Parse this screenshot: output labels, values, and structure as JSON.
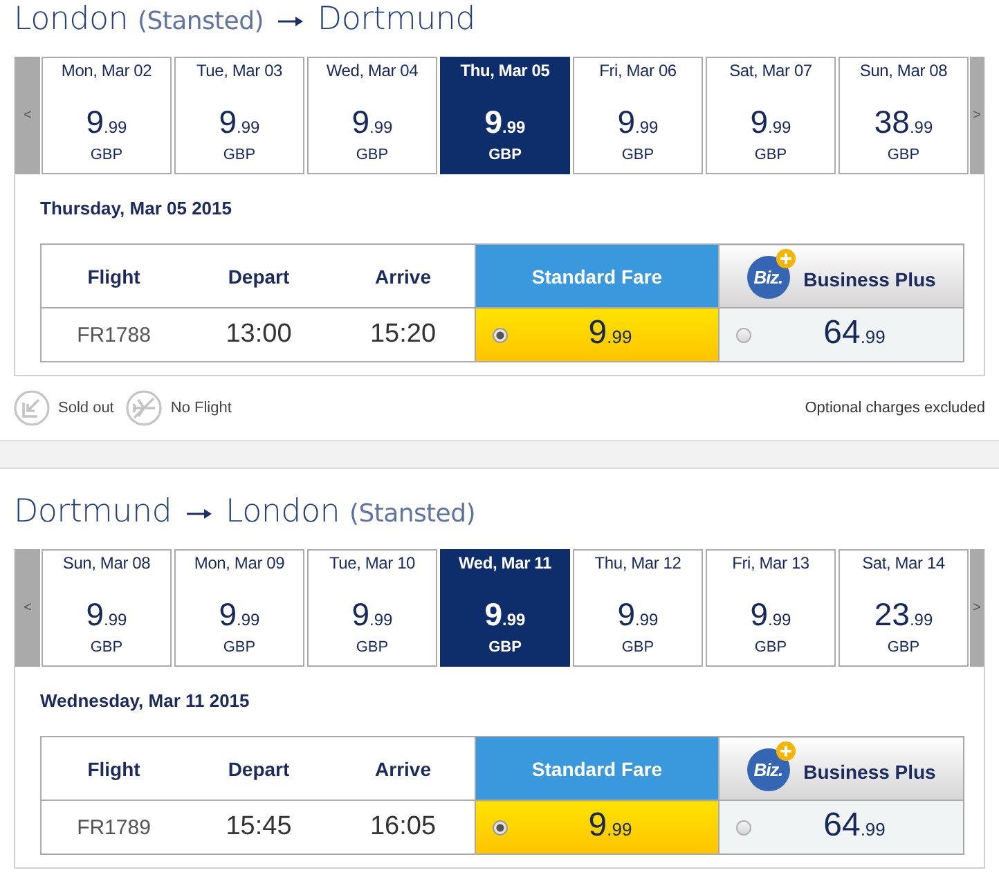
{
  "journeys": [
    {
      "route": {
        "origin": "London",
        "origin_note": "(Stansted)",
        "destination": "Dortmund"
      },
      "date_strip": {
        "previous": "<",
        "next": ">",
        "days": [
          {
            "date": "Mon, Mar 02",
            "price": "9",
            "cents": ".99",
            "currency": "GBP",
            "selected": false
          },
          {
            "date": "Tue, Mar 03",
            "price": "9",
            "cents": ".99",
            "currency": "GBP",
            "selected": false
          },
          {
            "date": "Wed, Mar 04",
            "price": "9",
            "cents": ".99",
            "currency": "GBP",
            "selected": false
          },
          {
            "date": "Thu, Mar 05",
            "price": "9",
            "cents": ".99",
            "currency": "GBP",
            "selected": true
          },
          {
            "date": "Fri, Mar 06",
            "price": "9",
            "cents": ".99",
            "currency": "GBP",
            "selected": false
          },
          {
            "date": "Sat, Mar 07",
            "price": "9",
            "cents": ".99",
            "currency": "GBP",
            "selected": false
          },
          {
            "date": "Sun, Mar 08",
            "price": "38",
            "cents": ".99",
            "currency": "GBP",
            "selected": false
          }
        ]
      },
      "selected_date": "Thursday, Mar 05 2015",
      "table": {
        "columns": [
          "Flight",
          "Depart",
          "Arrive"
        ],
        "fares": [
          {
            "kind": "standard",
            "name": "Standard Fare"
          },
          {
            "kind": "business",
            "name": "Business Plus",
            "logo": "Biz."
          }
        ],
        "rows": [
          {
            "flight": "FR1788",
            "depart": "13:00",
            "arrive": "15:20",
            "fares": [
              {
                "price": "9",
                "cents": ".99",
                "selected": true
              },
              {
                "price": "64",
                "cents": ".99",
                "selected": false
              }
            ]
          }
        ]
      },
      "legend": {
        "items": [
          {
            "kind": "sold_out",
            "label": "Sold out"
          },
          {
            "kind": "no_flight",
            "label": "No Flight"
          }
        ],
        "note": "Optional charges excluded"
      }
    },
    {
      "route": {
        "origin": "Dortmund",
        "destination": "London",
        "destination_note": "(Stansted)"
      },
      "date_strip": {
        "previous": "<",
        "next": ">",
        "days": [
          {
            "date": "Sun, Mar 08",
            "price": "9",
            "cents": ".99",
            "currency": "GBP",
            "selected": false
          },
          {
            "date": "Mon, Mar 09",
            "price": "9",
            "cents": ".99",
            "currency": "GBP",
            "selected": false
          },
          {
            "date": "Tue, Mar 10",
            "price": "9",
            "cents": ".99",
            "currency": "GBP",
            "selected": false
          },
          {
            "date": "Wed, Mar 11",
            "price": "9",
            "cents": ".99",
            "currency": "GBP",
            "selected": true
          },
          {
            "date": "Thu, Mar 12",
            "price": "9",
            "cents": ".99",
            "currency": "GBP",
            "selected": false
          },
          {
            "date": "Fri, Mar 13",
            "price": "9",
            "cents": ".99",
            "currency": "GBP",
            "selected": false
          },
          {
            "date": "Sat, Mar 14",
            "price": "23",
            "cents": ".99",
            "currency": "GBP",
            "selected": false
          }
        ]
      },
      "selected_date": "Wednesday, Mar 11 2015",
      "table": {
        "columns": [
          "Flight",
          "Depart",
          "Arrive"
        ],
        "fares": [
          {
            "kind": "standard",
            "name": "Standard Fare"
          },
          {
            "kind": "business",
            "name": "Business Plus",
            "logo": "Biz."
          }
        ],
        "rows": [
          {
            "flight": "FR1789",
            "depart": "15:45",
            "arrive": "16:05",
            "fares": [
              {
                "price": "9",
                "cents": ".99",
                "selected": true
              },
              {
                "price": "64",
                "cents": ".99",
                "selected": false
              }
            ]
          }
        ]
      }
    }
  ]
}
